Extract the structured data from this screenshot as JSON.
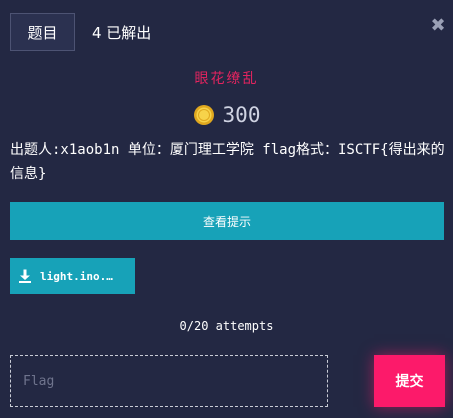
{
  "header": {
    "tab_label": "题目",
    "solves_text": "4 已解出",
    "close_glyph": "✖"
  },
  "challenge": {
    "name": "眼花缭乱",
    "points": "300",
    "description": "出题人:x1aob1n 单位：厦门理工学院 flag格式：ISCTF{得出来的信息}",
    "hint_label": "查看提示",
    "file_name": "light.ino.…",
    "attempts": "0/20 attempts"
  },
  "form": {
    "flag_placeholder": "Flag",
    "submit_label": "提交"
  },
  "colors": {
    "background": "#232843",
    "title": "#e2245f",
    "accent": "#17a2b8",
    "submit": "#fc1a6a",
    "coin": "#f2c12e"
  }
}
